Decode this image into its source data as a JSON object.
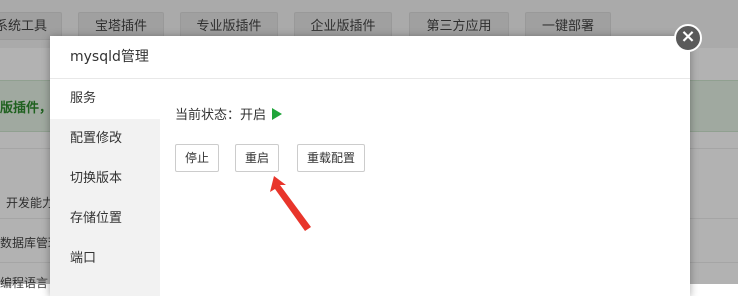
{
  "background": {
    "tabs": [
      "系统工具",
      "宝塔插件",
      "专业版插件",
      "企业版插件",
      "第三方应用",
      "一键部署"
    ],
    "banner_text": "版插件，",
    "row_texts": [
      "开发能力",
      "数据库管理器",
      "编程语言"
    ]
  },
  "dialog": {
    "title": "mysqld管理",
    "close_symbol": "×",
    "menu": [
      {
        "label": "服务",
        "active": true
      },
      {
        "label": "配置修改",
        "active": false
      },
      {
        "label": "切换版本",
        "active": false
      },
      {
        "label": "存储位置",
        "active": false
      },
      {
        "label": "端口",
        "active": false
      }
    ],
    "status_label": "当前状态：",
    "status_value": "开启",
    "status_icon": "play-icon",
    "status_color": "#20a53a",
    "buttons": {
      "stop": "停止",
      "restart": "重启",
      "reload": "重载配置"
    }
  },
  "annotation": {
    "arrow_color": "#e8352b"
  }
}
